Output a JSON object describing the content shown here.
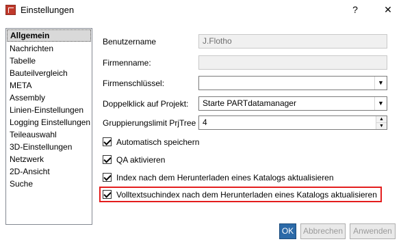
{
  "window": {
    "title": "Einstellungen",
    "help_label": "?",
    "close_label": "✕"
  },
  "sidebar": {
    "items": [
      {
        "label": "Allgemein",
        "selected": true
      },
      {
        "label": "Nachrichten"
      },
      {
        "label": "Tabelle"
      },
      {
        "label": "Bauteilvergleich"
      },
      {
        "label": "META"
      },
      {
        "label": "Assembly"
      },
      {
        "label": "Linien-Einstellungen"
      },
      {
        "label": "Logging Einstellungen"
      },
      {
        "label": "Teileauswahl"
      },
      {
        "label": "3D-Einstellungen"
      },
      {
        "label": "Netzwerk"
      },
      {
        "label": "2D-Ansicht"
      },
      {
        "label": "Suche"
      }
    ]
  },
  "form": {
    "username": {
      "label": "Benutzername",
      "value": "J.Flotho"
    },
    "company_name": {
      "label": "Firmenname:",
      "value": ""
    },
    "company_key": {
      "label": "Firmenschlüssel:",
      "value": ""
    },
    "double_click": {
      "label": "Doppelklick auf Projekt:",
      "value": "Starte PARTdatamanager"
    },
    "grouping_limit": {
      "label": "Gruppierungslimit PrjTree",
      "value": "4"
    }
  },
  "checkboxes": [
    {
      "label": "Automatisch speichern",
      "checked": true
    },
    {
      "label": "QA aktivieren",
      "checked": true
    },
    {
      "label": "Index nach dem Herunterladen eines Katalogs aktualisieren",
      "checked": true
    },
    {
      "label": "Volltextsuchindex nach dem Herunterladen eines Katalogs aktualisieren",
      "checked": true
    }
  ],
  "buttons": {
    "ok": "OK",
    "cancel": "Abbrechen",
    "apply": "Anwenden"
  },
  "colors": {
    "highlight": "#e31c1c",
    "ok_button": "#2c6aa8"
  }
}
